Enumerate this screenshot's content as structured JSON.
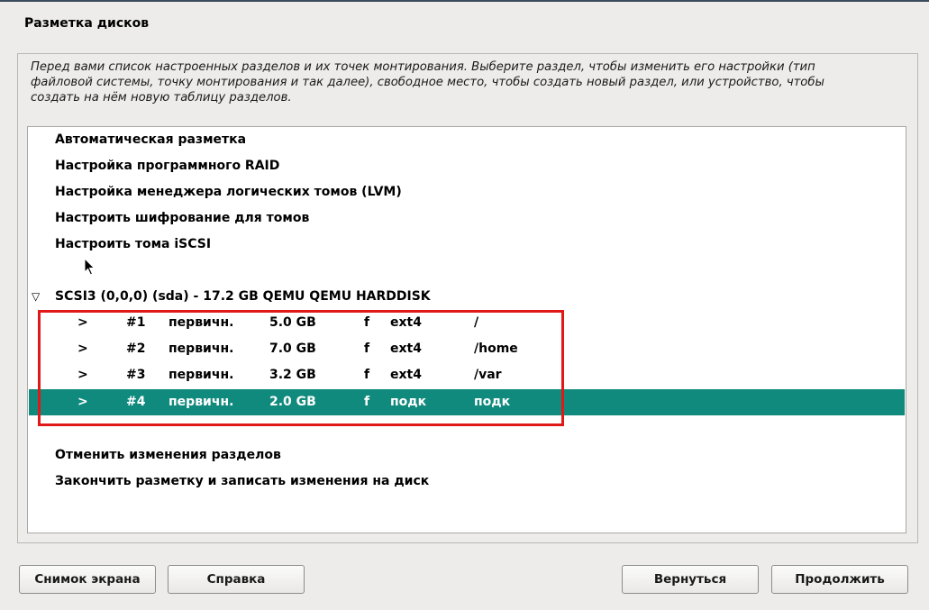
{
  "header": {
    "title": "Разметка дисков"
  },
  "description": "Перед вами список настроенных разделов и их точек монтирования. Выберите раздел, чтобы изменить его настройки (тип файловой системы, точку монтирования и так далее), свободное место, чтобы создать новый раздел, или устройство, чтобы создать на нём новую таблицу разделов.",
  "menu": {
    "auto": "Автоматическая разметка",
    "raid": "Настройка программного RAID",
    "lvm": "Настройка менеджера логических томов (LVM)",
    "crypto": "Настроить шифрование для томов",
    "iscsi": "Настроить тома iSCSI"
  },
  "disk": {
    "expand_glyph": "▽",
    "label": "SCSI3 (0,0,0) (sda) - 17.2 GB QEMU QEMU HARDDISK"
  },
  "partitions": [
    {
      "arrow": ">",
      "num": "#1",
      "type": "первичн.",
      "size": "5.0 GB",
      "flag": "f",
      "fs": "ext4",
      "mount": "/"
    },
    {
      "arrow": ">",
      "num": "#2",
      "type": "первичн.",
      "size": "7.0 GB",
      "flag": "f",
      "fs": "ext4",
      "mount": "/home"
    },
    {
      "arrow": ">",
      "num": "#3",
      "type": "первичн.",
      "size": "3.2 GB",
      "flag": "f",
      "fs": "ext4",
      "mount": "/var"
    },
    {
      "arrow": ">",
      "num": "#4",
      "type": "первичн.",
      "size": "2.0 GB",
      "flag": "f",
      "fs": "подк",
      "mount": "подк"
    }
  ],
  "actions": {
    "undo": "Отменить изменения разделов",
    "finish": "Закончить разметку и записать изменения на диск"
  },
  "buttons": {
    "screenshot": "Снимок экрана",
    "help": "Справка",
    "back": "Вернуться",
    "continue": "Продолжить"
  },
  "colors": {
    "selection": "#118a7e",
    "annotation_box": "#e01818"
  },
  "selected_partition": "#4"
}
